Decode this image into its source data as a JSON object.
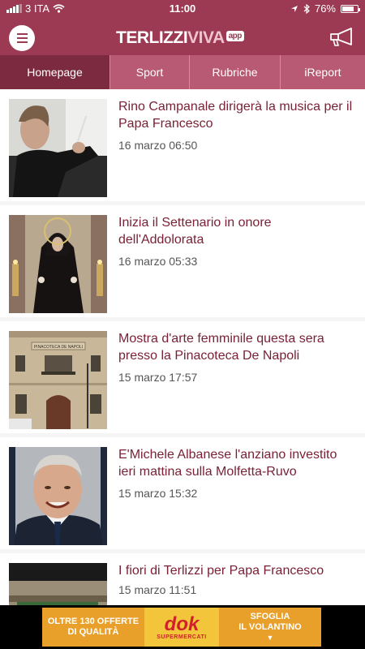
{
  "status_bar": {
    "carrier": "3 ITA",
    "time": "11:00",
    "battery": "76%"
  },
  "header": {
    "logo_part1": "TERLIZZI",
    "logo_part2": "VIVA",
    "logo_badge": "app"
  },
  "tabs": [
    {
      "label": "Homepage",
      "active": true
    },
    {
      "label": "Sport",
      "active": false
    },
    {
      "label": "Rubriche",
      "active": false
    },
    {
      "label": "iReport",
      "active": false
    }
  ],
  "articles": [
    {
      "title": "Rino Campanale dirigerà la musica per il Papa Francesco",
      "date": "16 marzo 06:50"
    },
    {
      "title": "Inizia il Settenario in onore dell'Addolorata",
      "date": "16 marzo 05:33"
    },
    {
      "title": "Mostra d'arte femminile questa sera presso la Pinacoteca De Napoli",
      "date": "15 marzo 17:57"
    },
    {
      "title": "E'Michele Albanese l'anziano investito ieri mattina sulla Molfetta-Ruvo",
      "date": "15 marzo 15:32"
    },
    {
      "title": "I fiori di Terlizzi per Papa Francesco",
      "date": "15 marzo 11:51"
    }
  ],
  "thumb_text": {
    "pinacoteca_sign": "PINACOTECA DE NAPOLI"
  },
  "banner": {
    "left_line1": "OLTRE 130 OFFERTE",
    "left_line2": "DI QUALITÀ",
    "brand": "dok",
    "brand_sub": "SUPERMERCATI",
    "right_line1": "SFOGLIA",
    "right_line2": "IL VOLANTINO",
    "right_arrow": "▼"
  },
  "colors": {
    "primary": "#9b3a52",
    "tabs_bg": "#b85a74",
    "tab_active": "#7c2a40",
    "title_text": "#7a2137"
  }
}
